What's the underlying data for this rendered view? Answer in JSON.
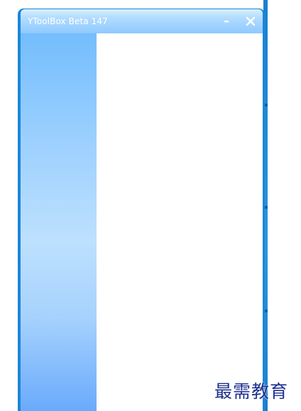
{
  "window": {
    "title": "YToolBox Beta 147",
    "minimize_icon": "minimize-icon",
    "close_icon": "close-icon"
  },
  "watermark": {
    "text": "最需教育"
  },
  "colors": {
    "window_frame": "#1c86d6",
    "titlebar_top": "#d7f0ff",
    "titlebar_bottom": "#8ec9ff",
    "sidebar_top": "#74bdfd",
    "sidebar_mid": "#bde0fe",
    "sidebar_bottom": "#6aaafc",
    "content_bg": "#ffffff",
    "watermark_text": "#1c2f8f"
  }
}
